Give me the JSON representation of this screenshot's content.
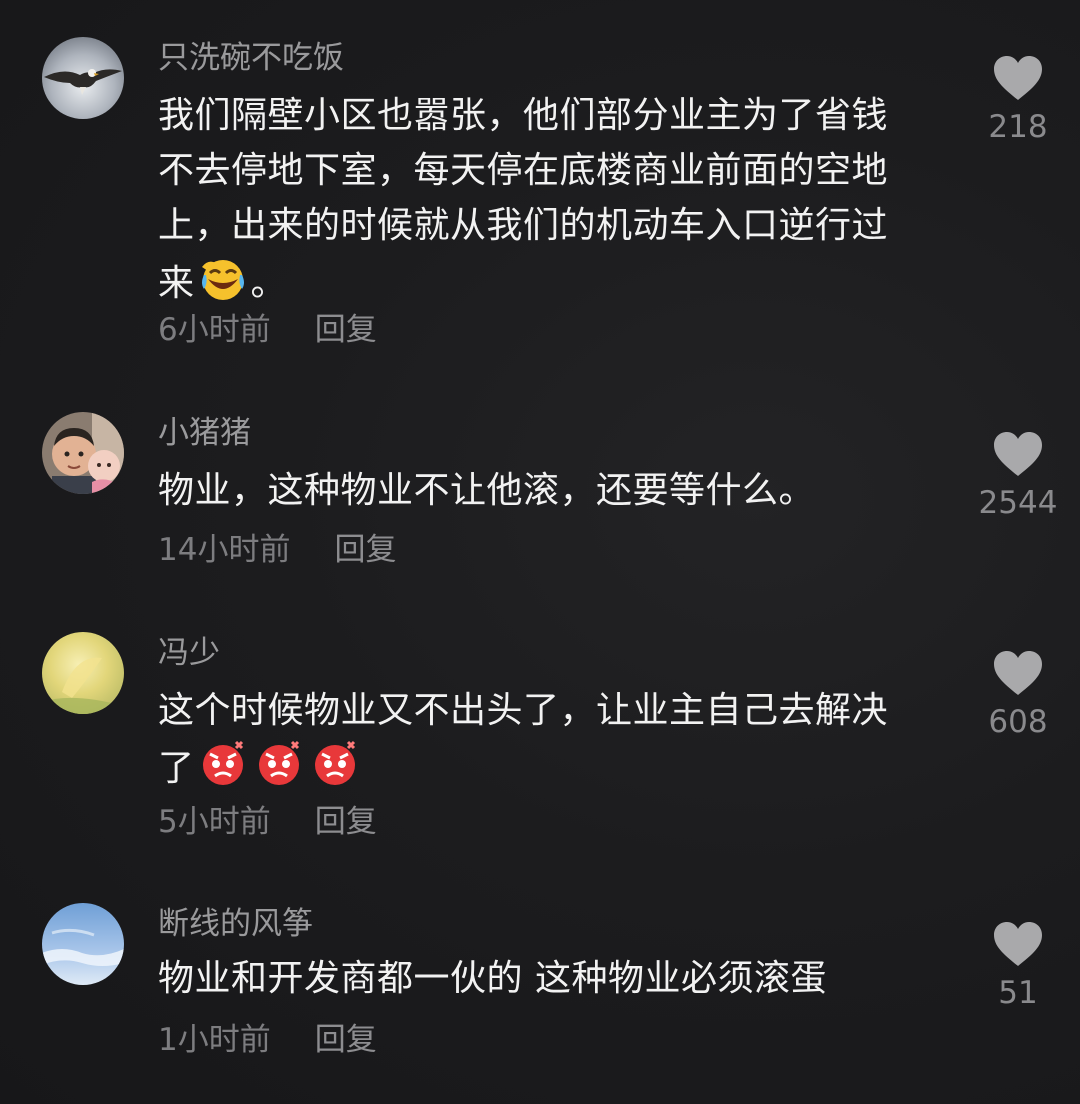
{
  "comments": [
    {
      "username": "只洗碗不吃饭",
      "text_lines": [
        "我们隔壁小区也嚣张，他们部分业主为了省钱",
        "不去停地下室，每天停在底楼商业前面的空地",
        "上，出来的时候就从我们的机动车入口逆行过",
        "来"
      ],
      "text_tail": "。",
      "emoji": "rolling-laughing-emoji",
      "time": "6小时前",
      "reply_label": "回复",
      "likes": "218",
      "avatar_icon": "eagle-avatar"
    },
    {
      "username": "小猪猪",
      "text_lines": [
        "物业，这种物业不让他滚，还要等什么。"
      ],
      "time": "14小时前",
      "reply_label": "回复",
      "likes": "2544",
      "avatar_icon": "family-photo-avatar"
    },
    {
      "username": "冯少",
      "text_lines": [
        "这个时候物业又不出头了，让业主自己去解决",
        "了"
      ],
      "emoji": "angry-face-emoji",
      "emoji_count": 3,
      "time": "5小时前",
      "reply_label": "回复",
      "likes": "608",
      "avatar_icon": "yellow-flower-avatar"
    },
    {
      "username": "断线的风筝",
      "text_lines": [
        "物业和开发商都一伙的 这种物业必须滚蛋"
      ],
      "time": "1小时前",
      "reply_label": "回复",
      "likes": "51",
      "avatar_icon": "blue-sky-avatar"
    }
  ],
  "colors": {
    "background": "#1b1b1d",
    "username": "#9a9a9c",
    "text": "#f2f2f2",
    "meta": "#7d7d80",
    "heart": "#a9a9ab"
  }
}
